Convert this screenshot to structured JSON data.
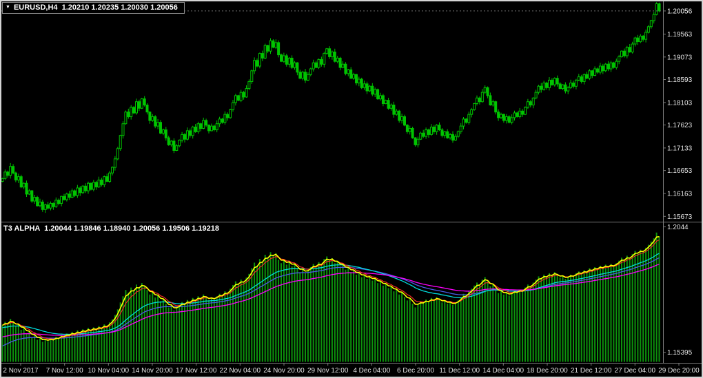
{
  "window": {
    "title_text": "EURUSD,H4  1.20210 1.20235 1.20030 1.20056"
  },
  "indicator_panel": {
    "label_text": "T3 ALPHA  1.20044 1.19846 1.18940 1.20056 1.19506 1.19218"
  },
  "colors": {
    "background": "#000000",
    "frame": "#D4D4D4",
    "separator": "#7A7A7A",
    "scale_text": "#E4E4E4",
    "candle": "#00C400",
    "bid_line": "#6F6F6F",
    "title_text": "#FFFFFF"
  },
  "chart_data": {
    "type": "candlestick",
    "symbol": "EURUSD",
    "timeframe": "H4",
    "last_bar_ohlc": {
      "open": 1.2021,
      "high": 1.20235,
      "low": 1.2003,
      "close": 1.20056
    },
    "main_ylim": [
      1.1556,
      1.2026
    ],
    "price_scale": {
      "current": "1.20056",
      "ticks": [
        "1.19563",
        "1.19073",
        "1.18593",
        "1.18103",
        "1.17623",
        "1.17133",
        "1.16653",
        "1.16163",
        "1.15673"
      ]
    },
    "time_labels": [
      "2 Nov 2017",
      "7 Nov 12:00",
      "10 Nov 04:00",
      "14 Nov 20:00",
      "17 Nov 12:00",
      "22 Nov 04:00",
      "24 Nov 20:00",
      "29 Nov 12:00",
      "4 Dec 04:00",
      "6 Dec 20:00",
      "11 Dec 12:00",
      "14 Dec 04:00",
      "18 Dec 20:00",
      "21 Dec 12:00",
      "27 Dec 04:00",
      "29 Dec 20:00"
    ],
    "indicator": {
      "name": "T3 ALPHA",
      "display_values": [
        "1.20044",
        "1.19846",
        "1.18940",
        "1.20056",
        "1.19506",
        "1.19218"
      ],
      "scale_labels": [
        "1.2044",
        "1.15395"
      ],
      "ylim": [
        1.15,
        1.2062
      ],
      "series": [
        {
          "name": "t3-histogram",
          "style": "histogram",
          "period": 1,
          "color": "#0C930C",
          "width": 2
        },
        {
          "name": "t3-base-line",
          "style": "line",
          "period": 35,
          "seed": 1.156,
          "color": "#4A5BE6",
          "width": 1.3
        },
        {
          "name": "t3-mid-line",
          "style": "line",
          "period": 25,
          "seed": 1.1638,
          "color": "#00DCDC",
          "width": 1.3
        },
        {
          "name": "t3-slow-line",
          "style": "line",
          "period": 55,
          "seed": 1.16,
          "color": "#FF00FF",
          "width": 1.3
        },
        {
          "name": "t3-signal-line",
          "style": "line",
          "period": 6,
          "color": "#FF2A2A",
          "width": 1.1
        },
        {
          "name": "t3-fast-line",
          "style": "line",
          "period": 3,
          "color": "#FFFF00",
          "width": 1.6
        }
      ]
    },
    "closes": [
      1.1648,
      1.1662,
      1.1655,
      1.1674,
      1.166,
      1.1645,
      1.1652,
      1.163,
      1.1638,
      1.1615,
      1.1622,
      1.16,
      1.1608,
      1.159,
      1.1598,
      1.1582,
      1.1592,
      1.1585,
      1.1595,
      1.1588,
      1.1602,
      1.1595,
      1.161,
      1.1603,
      1.1615,
      1.1608,
      1.1622,
      1.1612,
      1.1628,
      1.1618,
      1.1632,
      1.1622,
      1.1638,
      1.1625,
      1.164,
      1.163,
      1.1645,
      1.1635,
      1.1652,
      1.1642,
      1.166,
      1.1672,
      1.169,
      1.1712,
      1.174,
      1.1765,
      1.179,
      1.178,
      1.18,
      1.1788,
      1.1812,
      1.1798,
      1.1818,
      1.1805,
      1.179,
      1.1772,
      1.178,
      1.176,
      1.1768,
      1.1745,
      1.1752,
      1.1735,
      1.172,
      1.1728,
      1.1708,
      1.1718,
      1.173,
      1.1742,
      1.1732,
      1.175,
      1.174,
      1.1758,
      1.1748,
      1.1765,
      1.1755,
      1.1772,
      1.1762,
      1.175,
      1.176,
      1.1752,
      1.1765,
      1.1775,
      1.1768,
      1.1785,
      1.1778,
      1.1795,
      1.181,
      1.1825,
      1.1815,
      1.1832,
      1.1822,
      1.184,
      1.1855,
      1.1878,
      1.19,
      1.1888,
      1.1915,
      1.1905,
      1.1932,
      1.192,
      1.1942,
      1.1928,
      1.1938,
      1.1912,
      1.1898,
      1.191,
      1.1892,
      1.1905,
      1.1885,
      1.1895,
      1.1875,
      1.1862,
      1.1875,
      1.1858,
      1.187,
      1.1882,
      1.1895,
      1.1885,
      1.1902,
      1.1892,
      1.1915,
      1.1925,
      1.1908,
      1.1918,
      1.1898,
      1.1905,
      1.1885,
      1.1892,
      1.1872,
      1.188,
      1.1862,
      1.187,
      1.1852,
      1.186,
      1.1842,
      1.185,
      1.1835,
      1.1845,
      1.1828,
      1.1838,
      1.1818,
      1.1825,
      1.1808,
      1.1815,
      1.1798,
      1.1805,
      1.1785,
      1.1792,
      1.1772,
      1.178,
      1.1762,
      1.1748,
      1.1755,
      1.1735,
      1.172,
      1.1732,
      1.1745,
      1.1738,
      1.1752,
      1.1742,
      1.1758,
      1.1748,
      1.1762,
      1.1752,
      1.174,
      1.1748,
      1.1735,
      1.1742,
      1.173,
      1.1738,
      1.1748,
      1.176,
      1.1775,
      1.1768,
      1.1785,
      1.1795,
      1.1808,
      1.182,
      1.1812,
      1.1832,
      1.1842,
      1.1825,
      1.1805,
      1.1812,
      1.179,
      1.1778,
      1.1785,
      1.1772,
      1.178,
      1.1768,
      1.1778,
      1.1788,
      1.178,
      1.1792,
      1.1785,
      1.18,
      1.1812,
      1.1805,
      1.182,
      1.1832,
      1.1845,
      1.1838,
      1.1852,
      1.1842,
      1.1858,
      1.1848,
      1.1862,
      1.185,
      1.184,
      1.1848,
      1.1835,
      1.1842,
      1.1852,
      1.1845,
      1.1858,
      1.1865,
      1.1855,
      1.187,
      1.1862,
      1.1878,
      1.1868,
      1.1882,
      1.1875,
      1.1888,
      1.1878,
      1.1892,
      1.1882,
      1.1895,
      1.1885,
      1.1898,
      1.1908,
      1.192,
      1.191,
      1.1928,
      1.1918,
      1.1935,
      1.1948,
      1.194,
      1.1952,
      1.1945,
      1.196,
      1.1972,
      1.1985,
      1.1998,
      1.2021,
      1.20056
    ]
  }
}
